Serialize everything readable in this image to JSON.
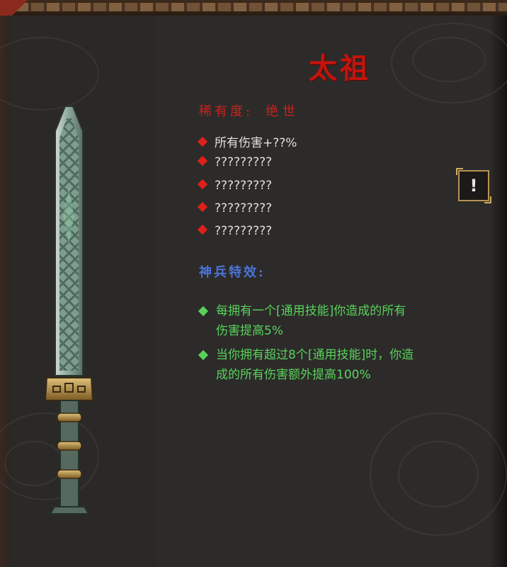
{
  "weapon": {
    "name": "太祖",
    "rarity_label": "稀有度:",
    "rarity_value": "绝世",
    "stats": [
      "所有伤害+??%",
      "?????????",
      "?????????",
      "?????????",
      "?????????"
    ]
  },
  "special": {
    "heading": "神兵特效:",
    "effects": [
      {
        "line1": "每拥有一个[通用技能]你造成的所有",
        "line2": "伤害提高5%"
      },
      {
        "line1": "当你拥有超过8个[通用技能]时，你造",
        "line2": "成的所有伤害额外提高100%"
      }
    ]
  },
  "side_button": {
    "icon": "exclamation-icon",
    "label": "!"
  },
  "colors": {
    "title": "#c4140c",
    "rarity": "#c8231b",
    "stat_bullet": "#e0201a",
    "special_heading": "#4c73d6",
    "effect_text": "#59d25a"
  }
}
